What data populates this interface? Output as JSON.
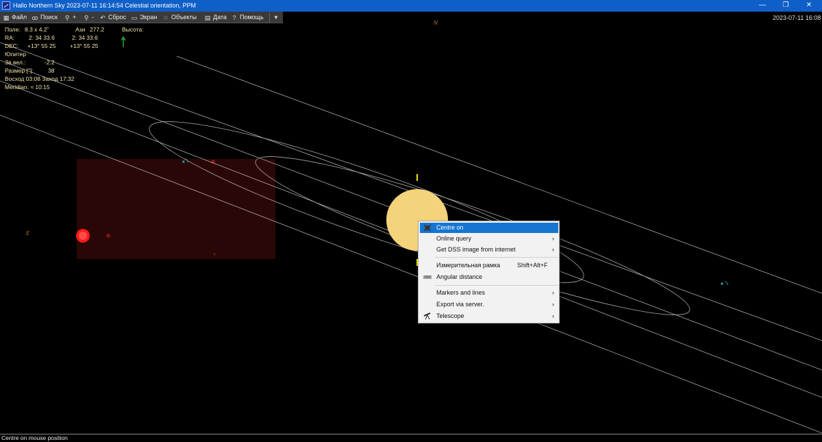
{
  "window": {
    "title": "Hallo Northern Sky   2023-07-11  16:14:54    Celestial orientation,   PPM",
    "minimize": "—",
    "maximize": "❐",
    "close": "✕"
  },
  "menubar": {
    "file": "Файл",
    "search": "Поиск",
    "zoom_in": "+",
    "zoom_out": "-",
    "reset": "Сброс",
    "screen": "Экран",
    "objects": "Объекты",
    "date": "Дата",
    "help": "Помощь"
  },
  "datetime": "2023-07-11  16:08",
  "info": {
    "field_label": "Поле:",
    "field_value": "8.3  x   4.2˚",
    "azimuth_label": "Ази",
    "azimuth_value": "277.2",
    "altitude_label": "Высота:",
    "ra_label": "RA:",
    "ra_value_1": "2: 34 33.6",
    "ra_value_2": "2: 34 33.6",
    "dec_label": "DEC:",
    "dec_value_1": "+13° 55 25",
    "dec_value_2": "+13° 55 25",
    "object_name": "Юпитер",
    "magnitude_label": "Зв.вел.:",
    "magnitude_value": "-2.2",
    "size_label": "Размер [\"]:",
    "size_value": "38",
    "rise_set": "Восход 03:08   Заход 17:32",
    "meridian": "Meridian:   ≈ 10:15"
  },
  "compass": {
    "north": "N",
    "east": "E"
  },
  "context_menu": {
    "centre_on": "Centre on",
    "online_query": "Online query",
    "get_dss": "Get DSS image from internet",
    "measure_frame": "Измерительная рамка",
    "measure_shortcut": "Shift+Alt+F",
    "angular_distance": "Angular distance",
    "markers_lines": "Markers and lines",
    "export_server": "Export via server.",
    "telescope": "Telescope",
    "submenu_arrow": "›"
  },
  "statusbar": "Centre on mouse position",
  "colors": {
    "titlebar": "#0f5fc8",
    "planet": "#f5d37a",
    "menu_highlight": "#1575d1",
    "dss_image": "#2a0707"
  }
}
